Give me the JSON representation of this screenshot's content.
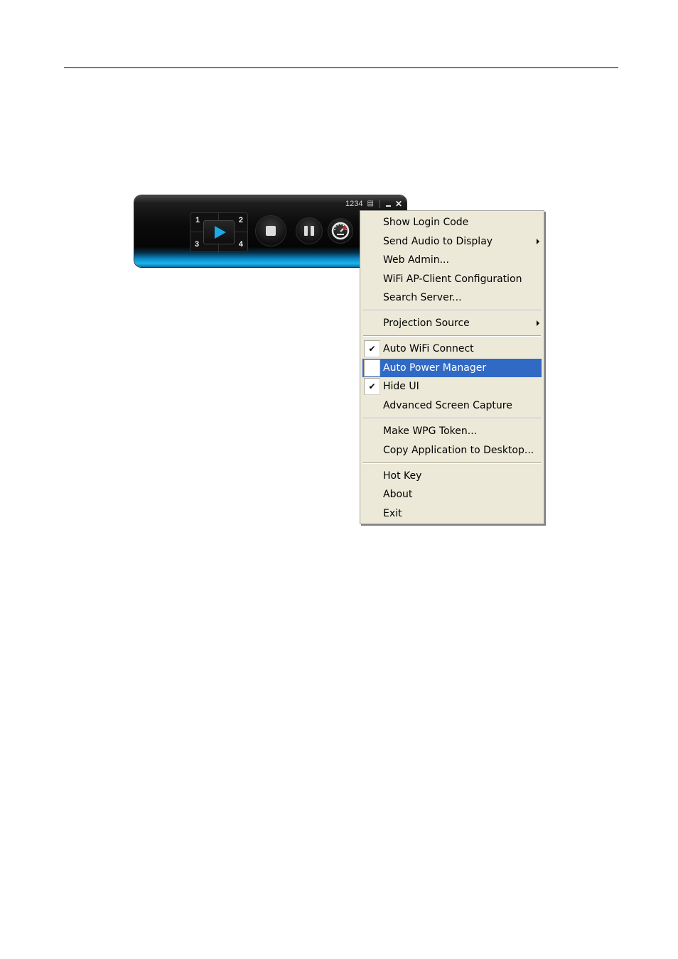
{
  "player": {
    "login_code": "1234",
    "quad_labels": [
      "1",
      "2",
      "3",
      "4"
    ],
    "buttons": {
      "play": "play-icon",
      "stop": "stop-icon",
      "pause": "pause-icon",
      "settings": "gauge-icon"
    },
    "window_controls": {
      "layout_icon": "▤",
      "minimize": "minimize-icon",
      "close": "✕"
    }
  },
  "menu": {
    "colors": {
      "background": "#ece9d8",
      "highlight": "#316ac5"
    },
    "items": [
      {
        "label": "Show Login Code"
      },
      {
        "label": "Send Audio to Display",
        "submenu": true
      },
      {
        "label": "Web Admin..."
      },
      {
        "label": "WiFi AP-Client Configuration"
      },
      {
        "label": "Search Server..."
      },
      {
        "label": "Projection Source",
        "submenu": true
      },
      {
        "label": "Auto WiFi Connect",
        "checked": true
      },
      {
        "label": "Auto Power Manager",
        "checked": true,
        "highlighted": true
      },
      {
        "label": "Hide UI",
        "checked": true
      },
      {
        "label": "Advanced Screen Capture"
      },
      {
        "label": "Make WPG Token..."
      },
      {
        "label": "Copy Application to Desktop..."
      },
      {
        "label": "Hot Key"
      },
      {
        "label": "About"
      },
      {
        "label": "Exit"
      }
    ],
    "check_glyph": "✔"
  }
}
